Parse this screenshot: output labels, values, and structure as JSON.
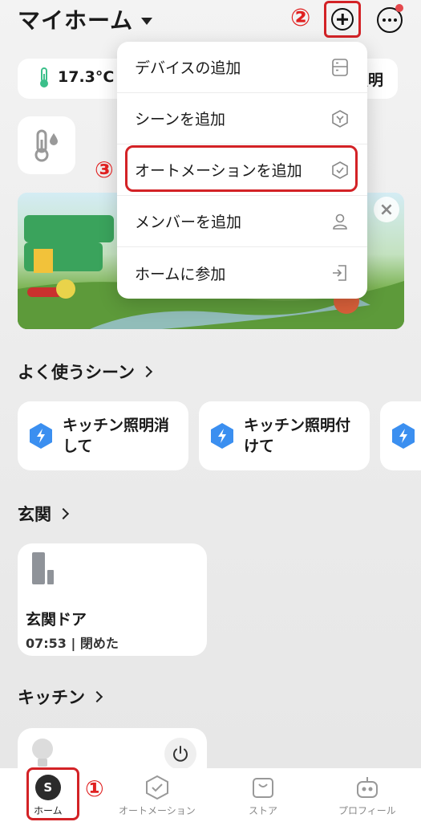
{
  "header": {
    "title": "マイホーム",
    "annotation_add": "②"
  },
  "weather": {
    "temperature": "17.3°C",
    "right_text": "照明"
  },
  "menu": {
    "items": [
      {
        "label": "デバイスの追加",
        "icon": "device-icon"
      },
      {
        "label": "シーンを追加",
        "icon": "scene-icon"
      },
      {
        "label": "オートメーションを追加",
        "icon": "automation-icon"
      },
      {
        "label": "メンバーを追加",
        "icon": "member-icon"
      },
      {
        "label": "ホームに参加",
        "icon": "join-icon"
      }
    ],
    "annotation": "③"
  },
  "sections": {
    "favorite_scenes": "よく使うシーン",
    "entrance": "玄関",
    "kitchen": "キッチン"
  },
  "scenes": [
    {
      "line1": "キッチン照明消",
      "line2": "して"
    },
    {
      "line1": "キッチン照明付",
      "line2": "けて"
    }
  ],
  "door": {
    "name": "玄関ドア",
    "status": "07:53 | 閉めた"
  },
  "bottom_nav": {
    "items": [
      {
        "label": "ホーム",
        "avatar": "S"
      },
      {
        "label": "オートメーション"
      },
      {
        "label": "ストア"
      },
      {
        "label": "プロフィール"
      }
    ],
    "annotation_home": "①"
  },
  "colors": {
    "highlight_red": "#d32226",
    "scene_icon_blue": "#3b8ff0"
  }
}
